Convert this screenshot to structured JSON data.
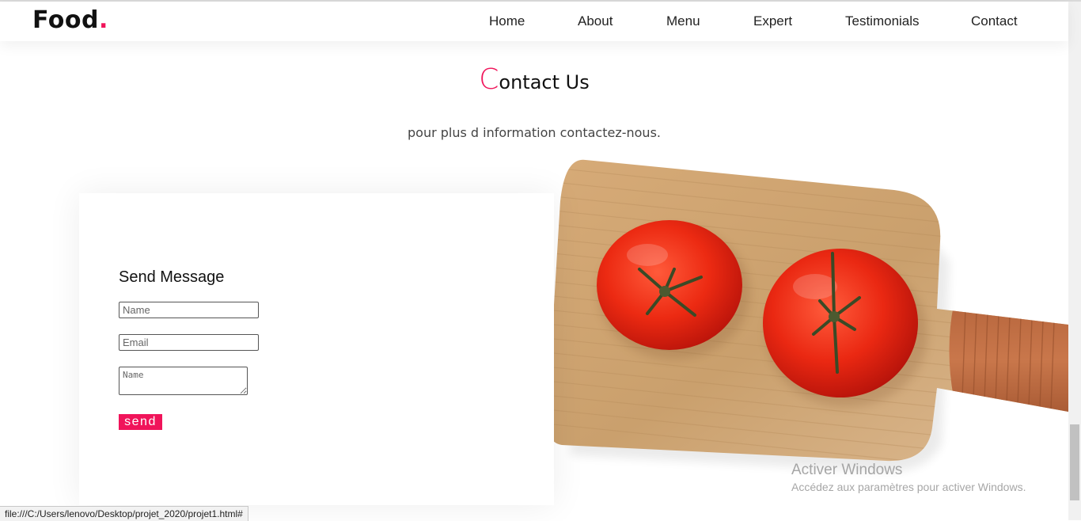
{
  "brand": {
    "name": "Food",
    "dot": "."
  },
  "nav": {
    "items": [
      {
        "label": "Home"
      },
      {
        "label": "About"
      },
      {
        "label": "Menu"
      },
      {
        "label": "Expert"
      },
      {
        "label": "Testimonials"
      },
      {
        "label": "Contact"
      }
    ]
  },
  "section": {
    "title_first": "C",
    "title_rest": "ontact Us",
    "subtitle": "pour plus d information contactez-nous."
  },
  "form": {
    "heading": "Send Message",
    "name_placeholder": "Name",
    "email_placeholder": "Email",
    "message_placeholder": "Name",
    "send_label": "send"
  },
  "os_watermark": {
    "title": "Activer Windows",
    "subtitle": "Accédez aux paramètres pour activer Windows."
  },
  "status_bar": {
    "url": "file:///C:/Users/lenovo/Desktop/projet_2020/projet1.html#"
  },
  "colors": {
    "accent": "#f0145a",
    "text": "#111111"
  },
  "image": {
    "subject": "two-tomatoes-on-wooden-cutting-board"
  }
}
